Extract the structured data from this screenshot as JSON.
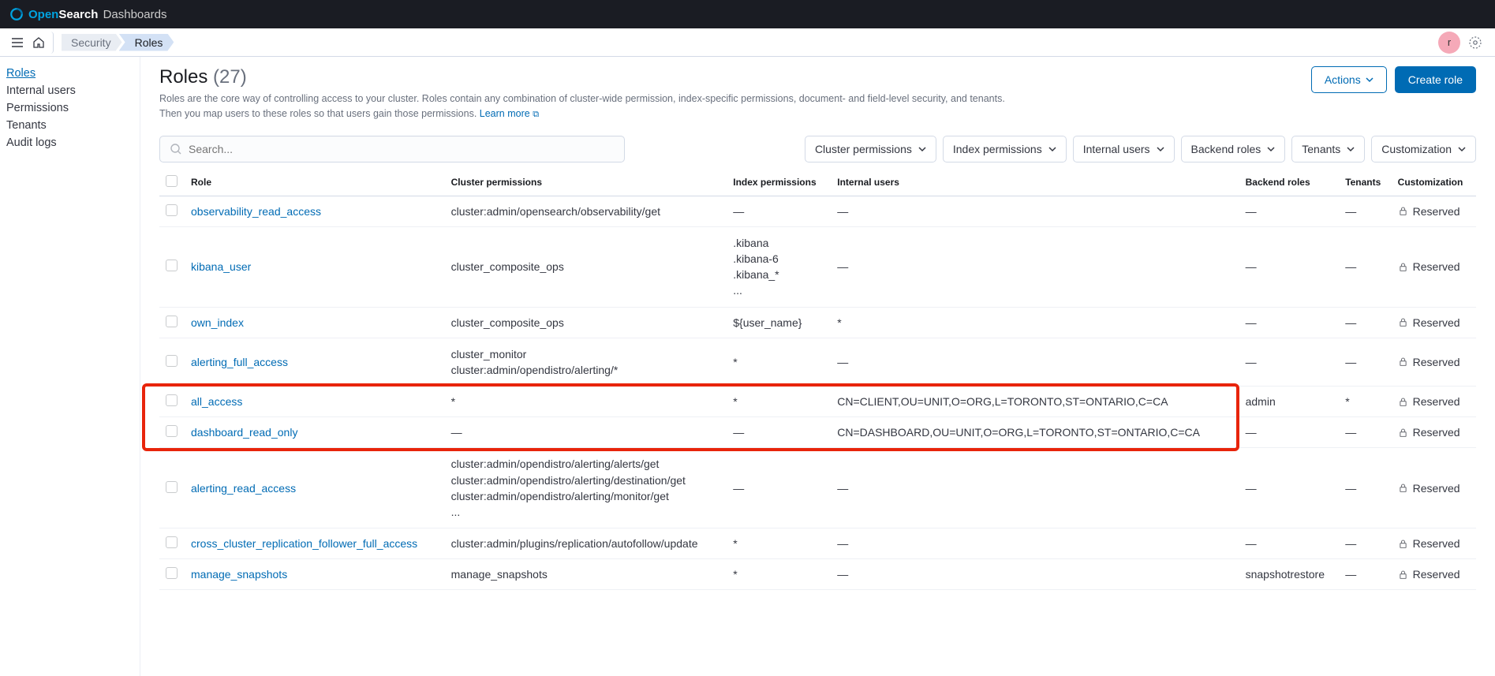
{
  "brand": {
    "open": "Open",
    "search": "Search",
    "dash": "Dashboards"
  },
  "breadcrumb": {
    "security": "Security",
    "roles": "Roles"
  },
  "avatar_letter": "r",
  "sidebar": {
    "items": [
      {
        "label": "Roles",
        "active": true
      },
      {
        "label": "Internal users",
        "active": false
      },
      {
        "label": "Permissions",
        "active": false
      },
      {
        "label": "Tenants",
        "active": false
      },
      {
        "label": "Audit logs",
        "active": false
      }
    ]
  },
  "page": {
    "title": "Roles",
    "count": "(27)",
    "desc": "Roles are the core way of controlling access to your cluster. Roles contain any combination of cluster-wide permission, index-specific permissions, document- and field-level security, and tenants. Then you map users to these roles so that users gain those permissions.",
    "learn_more": "Learn more"
  },
  "actions": {
    "actions_btn": "Actions",
    "create_btn": "Create role"
  },
  "search": {
    "placeholder": "Search..."
  },
  "filters": {
    "cluster": "Cluster permissions",
    "index": "Index permissions",
    "internal": "Internal users",
    "backend": "Backend roles",
    "tenants": "Tenants",
    "custom": "Customization"
  },
  "columns": {
    "role": "Role",
    "cluster": "Cluster permissions",
    "index": "Index permissions",
    "internal": "Internal users",
    "backend": "Backend roles",
    "tenants": "Tenants",
    "custom": "Customization"
  },
  "reserved_label": "Reserved",
  "rows": [
    {
      "role": "observability_read_access",
      "cluster": "cluster:admin/opensearch/observability/get",
      "index": "—",
      "internal": "—",
      "backend": "—",
      "tenants": "—",
      "custom": "Reserved"
    },
    {
      "role": "kibana_user",
      "cluster": "cluster_composite_ops",
      "index": ".kibana\n.kibana-6\n.kibana_*\n...",
      "internal": "—",
      "backend": "—",
      "tenants": "—",
      "custom": "Reserved"
    },
    {
      "role": "own_index",
      "cluster": "cluster_composite_ops",
      "index": "${user_name}",
      "internal": "*",
      "backend": "—",
      "tenants": "—",
      "custom": "Reserved"
    },
    {
      "role": "alerting_full_access",
      "cluster": "cluster_monitor\ncluster:admin/opendistro/alerting/*",
      "index": "*",
      "internal": "—",
      "backend": "—",
      "tenants": "—",
      "custom": "Reserved"
    },
    {
      "role": "all_access",
      "cluster": "*",
      "index": "*",
      "internal": "CN=CLIENT,OU=UNIT,O=ORG,L=TORONTO,ST=ONTARIO,C=CA",
      "backend": "admin",
      "tenants": "*",
      "custom": "Reserved"
    },
    {
      "role": "dashboard_read_only",
      "cluster": "—",
      "index": "—",
      "internal": "CN=DASHBOARD,OU=UNIT,O=ORG,L=TORONTO,ST=ONTARIO,C=CA",
      "backend": "—",
      "tenants": "—",
      "custom": "Reserved"
    },
    {
      "role": "alerting_read_access",
      "cluster": "cluster:admin/opendistro/alerting/alerts/get\ncluster:admin/opendistro/alerting/destination/get\ncluster:admin/opendistro/alerting/monitor/get\n...",
      "index": "—",
      "internal": "—",
      "backend": "—",
      "tenants": "—",
      "custom": "Reserved"
    },
    {
      "role": "cross_cluster_replication_follower_full_access",
      "cluster": "cluster:admin/plugins/replication/autofollow/update",
      "index": "*",
      "internal": "—",
      "backend": "—",
      "tenants": "—",
      "custom": "Reserved"
    },
    {
      "role": "manage_snapshots",
      "cluster": "manage_snapshots",
      "index": "*",
      "internal": "—",
      "backend": "snapshotrestore",
      "tenants": "—",
      "custom": "Reserved"
    }
  ],
  "highlight": {
    "row_start": 4,
    "row_end": 5
  }
}
